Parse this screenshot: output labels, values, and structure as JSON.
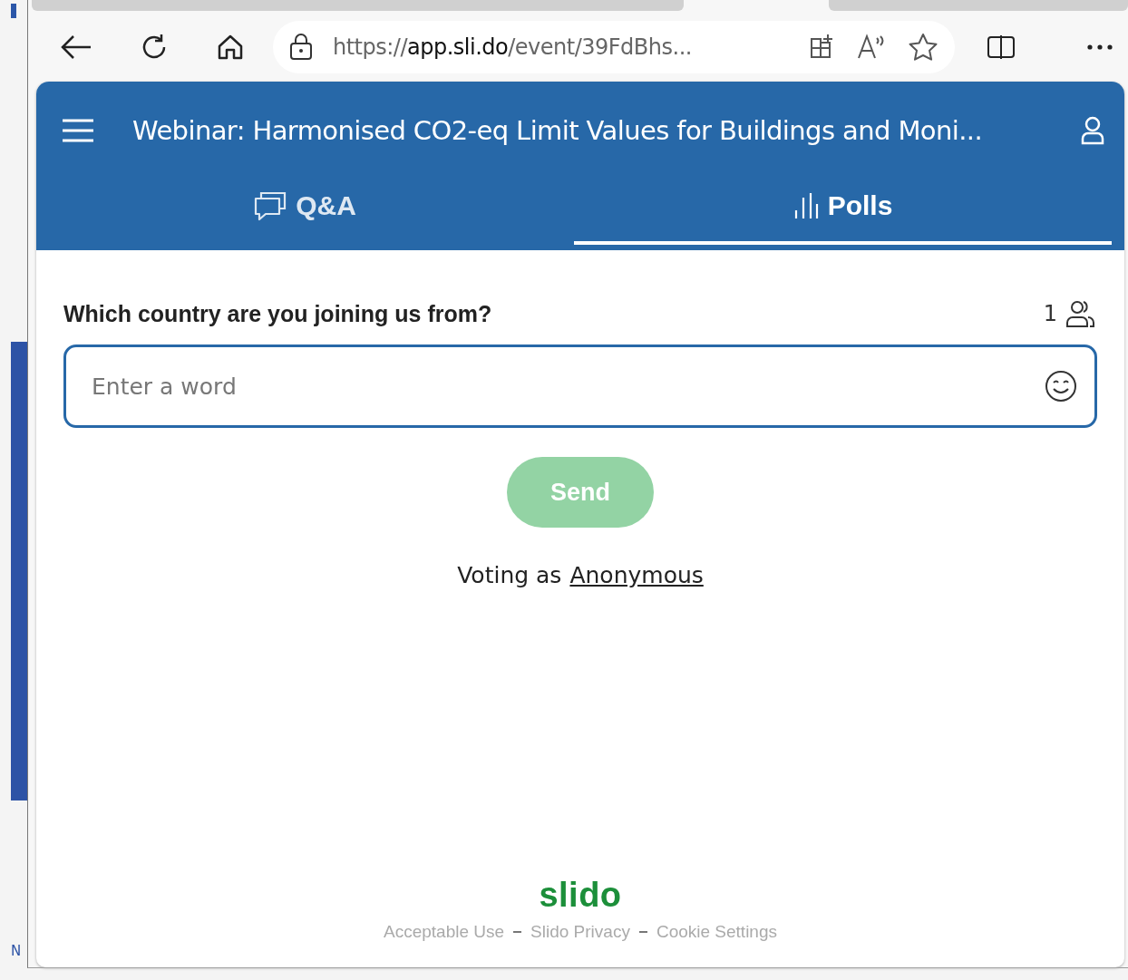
{
  "background": {
    "text": "N"
  },
  "browser": {
    "url": "https://app.sli.do/event/39FdBhs..."
  },
  "header": {
    "title": "Webinar: Harmonised CO2-eq Limit Values for Buildings and Moni..."
  },
  "tabs": [
    {
      "label": "Q&A",
      "kind": "qa",
      "selected": false
    },
    {
      "label": "Polls",
      "kind": "polls",
      "selected": true
    }
  ],
  "poll": {
    "question": "Which country are you joining us from?",
    "participants": "1",
    "placeholder": "Enter a word",
    "send": {
      "label": "Send",
      "disabled": true
    },
    "voting_as": "Voting as",
    "voter": "Anonymous"
  },
  "footer": {
    "logo": "slido",
    "links": [
      "Acceptable Use",
      "Slido Privacy",
      "Cookie Settings"
    ]
  }
}
